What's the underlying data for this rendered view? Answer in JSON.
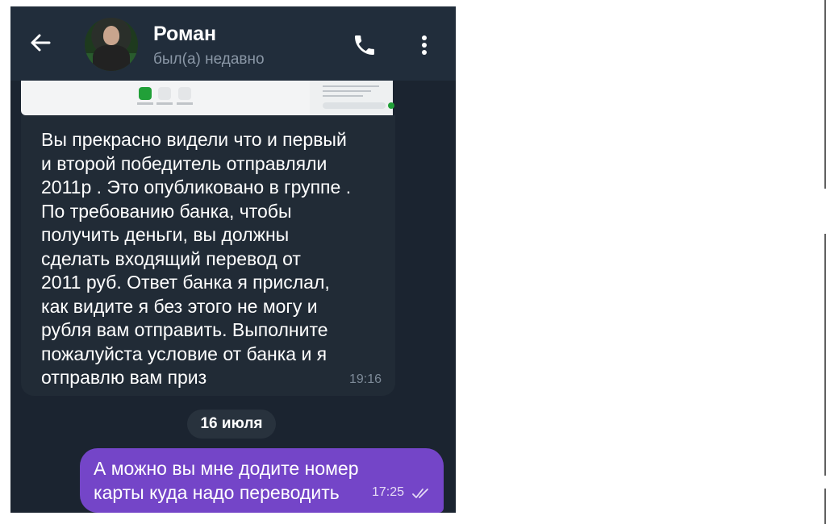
{
  "header": {
    "contact_name": "Роман",
    "status": "был(а) недавно",
    "icons": {
      "back": "arrow-left-icon",
      "call": "phone-icon",
      "menu": "more-vertical-icon"
    }
  },
  "messages": {
    "incoming": {
      "lines": [
        "Вы прекрасно видели что и первый",
        "и второй победитель отправляли",
        "2011р . Это опубликовано в группе .",
        "По требованию банка, чтобы",
        "получить деньги, вы должны",
        "сделать входящий перевод от",
        "2011 руб. Ответ банка я прислал,",
        "как видите я без этого не могу и",
        "рубля вам отправить. Выполните",
        "пожалуйста условие от банка и я",
        "отправлю вам приз"
      ],
      "time": "19:16"
    },
    "date_separator": "16 июля",
    "outgoing": {
      "lines": [
        "А можно вы мне додите номер",
        "карты куда надо переводить"
      ],
      "time": "17:25",
      "status_icon": "double-check-icon"
    }
  },
  "colors": {
    "background": "#1b2430",
    "header": "#212d3b",
    "incoming_bubble": "#212b36",
    "outgoing_bubble": "#7445c8"
  }
}
